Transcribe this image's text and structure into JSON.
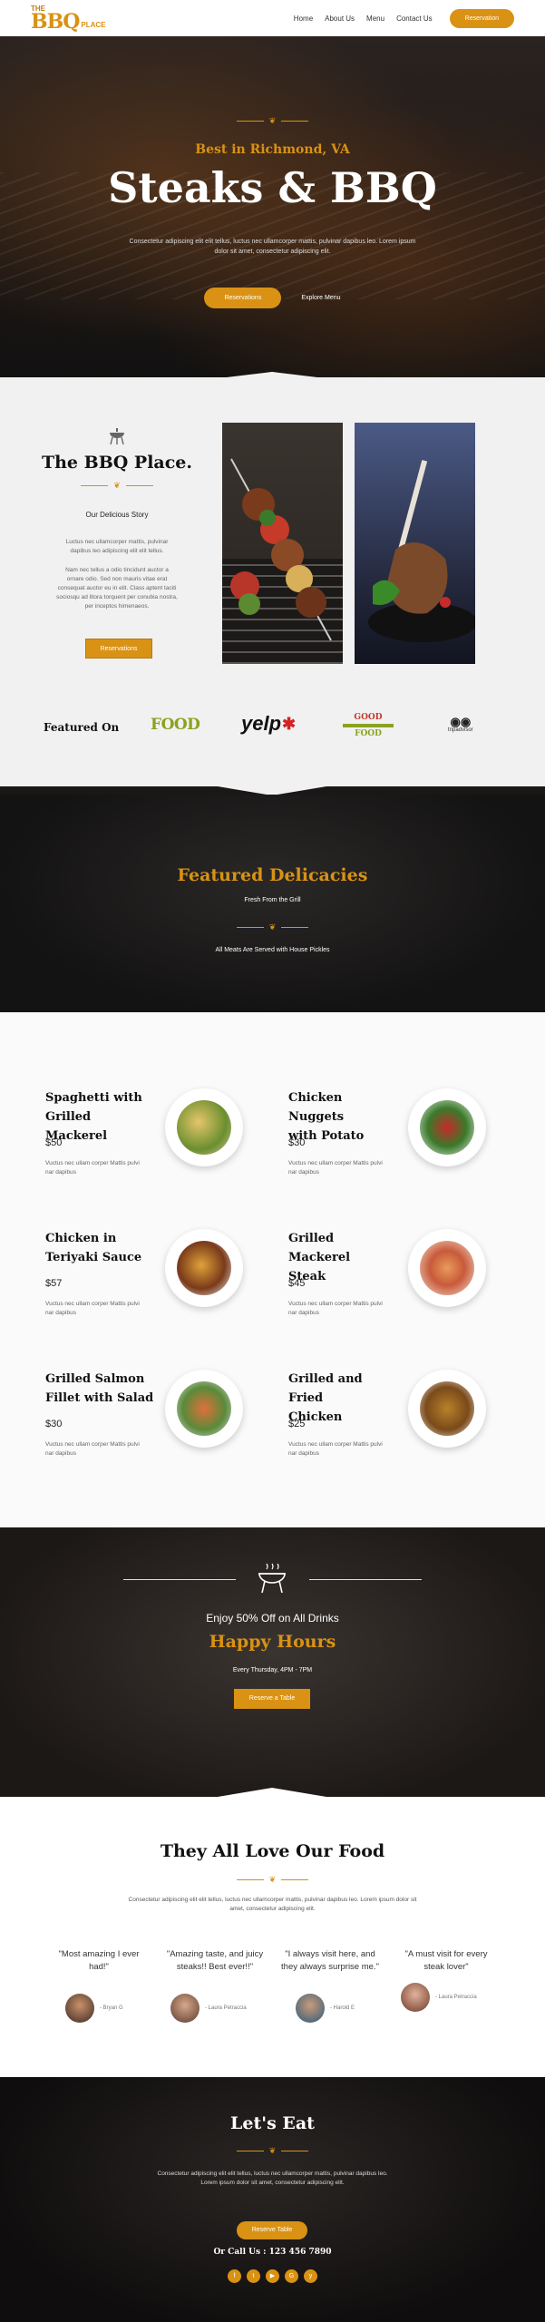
{
  "header": {
    "logo": {
      "the": "THE",
      "bbq": "BBQ",
      "place": "PLACE"
    },
    "nav": [
      "Home",
      "About Us",
      "Menu",
      "Contact Us"
    ],
    "cta": "Reservation"
  },
  "hero": {
    "subtitle": "Best in Richmond, VA",
    "title": "Steaks & BBQ",
    "text": "Consectetur adipiscing elit elit tellus, luctus nec ullamcorper mattis, pulvinar dapibus leo. Lorem ipsum dolor sit amet, consectetur adipiscing elit.",
    "primary_button": "Reservations",
    "secondary_link": "Explore Menu"
  },
  "about": {
    "title": "The BBQ Place.",
    "subtitle": "Our Delicious Story",
    "para1": "Luctus nec ullamcorper mattis, pulvinar dapibus leo adipiscing elit elit tellus.",
    "para2": "Nam nec tellus a odio tincidunt auctor a ornare odio. Sed non mauris vitae erat consequat auctor eu in elit. Class aptent taciti sociosqu ad litora torquent per conubia nostra, per inceptos himenaeos.",
    "button": "Reservations"
  },
  "featured_on": {
    "label": "Featured On",
    "logos": {
      "food": "FOOD",
      "yelp": "yelp",
      "goodfood_top": "GOOD",
      "goodfood_bottom": "FOOD",
      "tripadvisor": "tripadvisor"
    }
  },
  "delicacies": {
    "title": "Featured Delicacies",
    "subtitle": "Fresh From the Grill",
    "note": "All Meats Are Served with House Pickles"
  },
  "menu": [
    {
      "name_l1": "Spaghetti with",
      "name_l2": "Grilled Mackerel",
      "price": "$50",
      "desc": "Vuctus nec ullam corper Mattis pulvi nar dapibus"
    },
    {
      "name_l1": "Chicken Nuggets",
      "name_l2": "with Potato",
      "price": "$30",
      "desc": "Vuctus nec ullam corper Mattis pulvi nar dapibus"
    },
    {
      "name_l1": "Chicken in",
      "name_l2": "Teriyaki Sauce",
      "price": "$57",
      "desc": "Vuctus nec ullam corper Mattis pulvi nar dapibus"
    },
    {
      "name_l1": "Grilled Mackerel",
      "name_l2": "Steak",
      "price": "$45",
      "desc": "Vuctus nec ullam corper Mattis pulvi nar dapibus"
    },
    {
      "name_l1": "Grilled Salmon",
      "name_l2": "Fillet with Salad",
      "price": "$30",
      "desc": "Vuctus nec ullam corper Mattis pulvi nar dapibus"
    },
    {
      "name_l1": "Grilled and Fried",
      "name_l2": "Chicken",
      "price": "$25",
      "desc": "Vuctus nec ullam corper Mattis pulvi nar dapibus"
    }
  ],
  "happy_hours": {
    "offer": "Enjoy 50% Off on All Drinks",
    "title": "Happy Hours",
    "time": "Every Thursday, 4PM - 7PM",
    "button": "Reserve a Table"
  },
  "testimonials": {
    "title": "They All Love Our Food",
    "subtitle": "Consectetur adipiscing elit elit tellus, luctus nec ullamcorper mattis, pulvinar dapibus leo. Lorem ipsum dolor sit amet, consectetur adipiscing elit.",
    "items": [
      {
        "quote": "\"Most amazing I ever had!\"",
        "author": "- Bryan G"
      },
      {
        "quote": "\"Amazing taste, and juicy steaks!! Best ever!!\"",
        "author": "- Laura Petraccia"
      },
      {
        "quote": "\"I always visit here, and they always surprise me.\"",
        "author": "- Harold E"
      },
      {
        "quote": "\"A must visit for every steak lover\"",
        "author": "- Laura Petraccia"
      }
    ]
  },
  "lets_eat": {
    "title": "Let's Eat",
    "text": "Consectetur adipiscing elit elit tellus, luctus nec ullamcorper mattis, pulvinar dapibus leo. Lorem ipsum dolor sit amet, consectetur adipiscing elit.",
    "button": "Reserve Table",
    "call": "Or Call Us : 123 456 7890",
    "socials": {
      "facebook": "f",
      "twitter": "t",
      "youtube": "▶",
      "google": "G",
      "yelp": "y"
    }
  },
  "colors": {
    "accent": "#d99214",
    "dark": "#1c1816",
    "light_bg": "#f1f1f1"
  }
}
